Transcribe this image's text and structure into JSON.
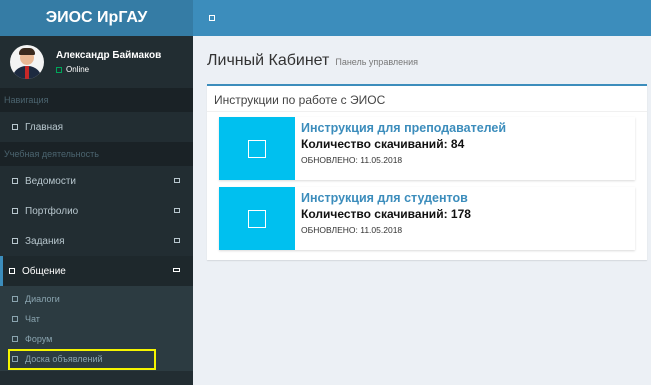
{
  "app": {
    "logo_text": "ЭИОС ИрГАУ"
  },
  "user": {
    "name": "Александр Баймаков",
    "status": "Online"
  },
  "sidebar": {
    "header_nav": "Навигация",
    "home": "Главная",
    "header_study": "Учебная деятельность",
    "items": [
      {
        "label": "Ведомости"
      },
      {
        "label": "Портфолио"
      },
      {
        "label": "Задания"
      },
      {
        "label": "Общение"
      }
    ],
    "submenu": [
      {
        "label": "Диалоги"
      },
      {
        "label": "Чат"
      },
      {
        "label": "Форум"
      },
      {
        "label": "Доска объявлений"
      }
    ]
  },
  "content": {
    "title": "Личный Кабинет",
    "subtitle": "Панель управления",
    "box_title": "Инструкции по работе с ЭИОС",
    "instructions": [
      {
        "title": "Инструкция для преподавателей",
        "count": "Количество скачиваний: 84",
        "updated": "ОБНОВЛЕНО: 11.05.2018"
      },
      {
        "title": "Инструкция для студентов",
        "count": "Количество скачиваний: 178",
        "updated": "ОБНОВЛЕНО: 11.05.2018"
      }
    ]
  },
  "colors": {
    "sidebar": "#222d32",
    "accent": "#3c8dbc",
    "icon_bg": "#00c0ef",
    "highlight": "#f5f500"
  },
  "icons": {
    "toggle": "square-icon",
    "menu": "square-icon",
    "caret": "square-icon"
  }
}
